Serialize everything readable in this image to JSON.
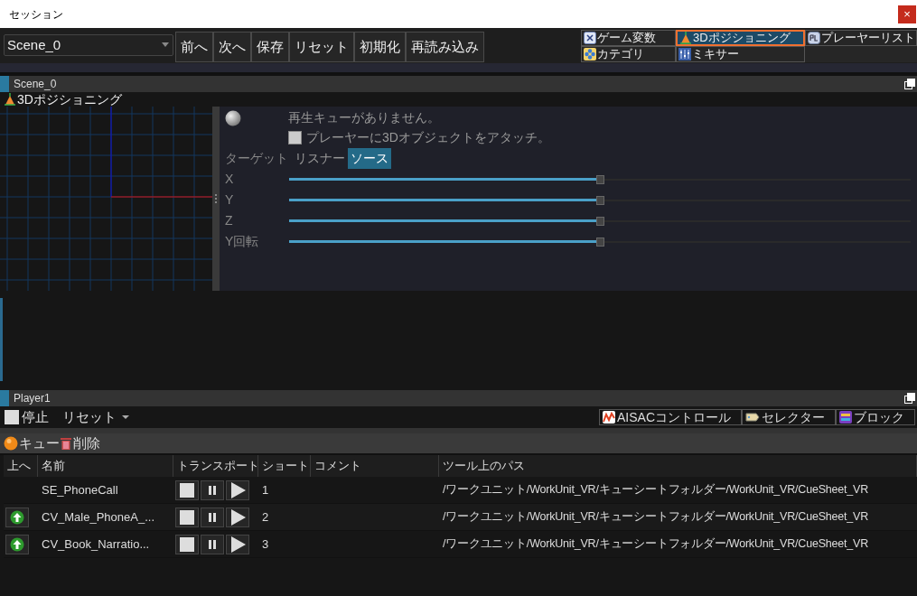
{
  "window": {
    "title": "セッション",
    "close": "×"
  },
  "toolbar": {
    "scene_select": "Scene_0",
    "buttons": [
      "前へ",
      "次へ",
      "保存",
      "リセット",
      "初期化",
      "再読み込み"
    ]
  },
  "view_buttons": [
    {
      "label": "ゲーム変数",
      "selected": false
    },
    {
      "label": "3Dポジショニング",
      "selected": true
    },
    {
      "label": "プレーヤーリスト",
      "selected": false
    },
    {
      "label": "カテゴリ",
      "selected": false
    },
    {
      "label": "ミキサー",
      "selected": false
    }
  ],
  "scene_panel": {
    "title": "Scene_0",
    "view_title": "3Dポジショニング",
    "status": "再生キューがありません。",
    "attach": {
      "label": "プレーヤーに3Dオブジェクトをアタッチ。",
      "checked": false
    },
    "target": {
      "label": "ターゲット",
      "options": [
        {
          "label": "リスナー",
          "selected": false
        },
        {
          "label": "ソース",
          "selected": true
        }
      ]
    },
    "sliders": [
      {
        "label": "X",
        "level": 0.5
      },
      {
        "label": "Y",
        "level": 0.5
      },
      {
        "label": "Z",
        "level": 0.5
      },
      {
        "label": "Y回転",
        "level": 0.5
      }
    ]
  },
  "player_panel": {
    "title": "Player1",
    "stop": "停止",
    "reset": "リセット",
    "tabs": [
      "AISACコントロール",
      "セレクター",
      "ブロック"
    ],
    "list_tabs": [
      "キュー",
      "削除"
    ],
    "columns": [
      "上へ",
      "名前",
      "トランスポート",
      "ショート",
      "コメント",
      "ツール上のパス"
    ],
    "rows": [
      {
        "up": false,
        "name": "SE_PhoneCall",
        "shortcut": "1",
        "path": "/ワークユニット/WorkUnit_VR/キューシートフォルダー/WorkUnit_VR/CueSheet_VR"
      },
      {
        "up": true,
        "name": "CV_Male_PhoneA_...",
        "shortcut": "2",
        "path": "/ワークユニット/WorkUnit_VR/キューシートフォルダー/WorkUnit_VR/CueSheet_VR"
      },
      {
        "up": true,
        "name": "CV_Book_Narratio...",
        "shortcut": "3",
        "path": "/ワークユニット/WorkUnit_VR/キューシートフォルダー/WorkUnit_VR/CueSheet_VR"
      }
    ]
  }
}
